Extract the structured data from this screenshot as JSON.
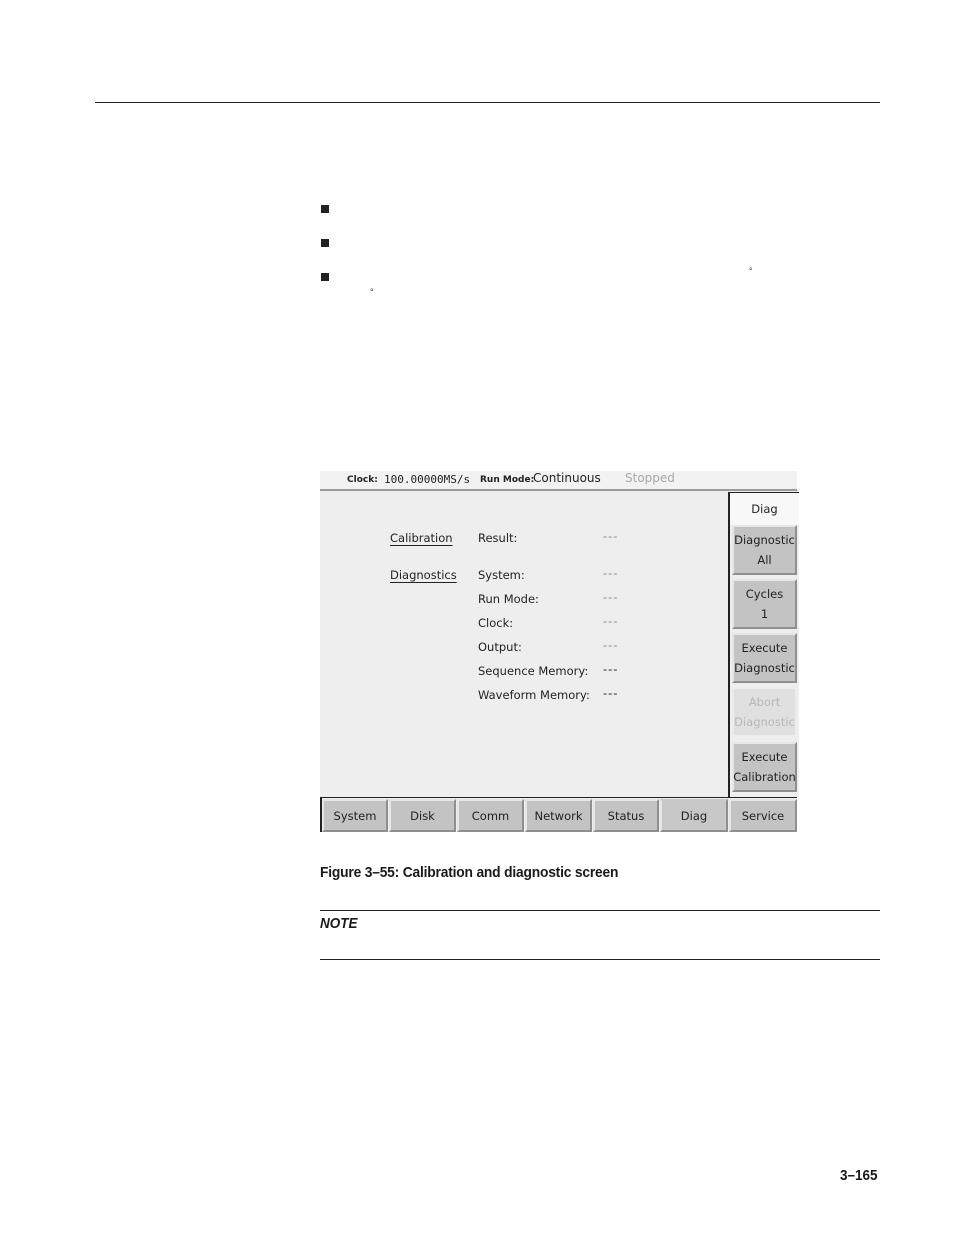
{
  "document": {
    "bullets": [
      "",
      "",
      ""
    ],
    "degree_marks": [
      "°",
      "°"
    ],
    "figure_caption": "Figure 3–55: Calibration and diagnostic screen",
    "note_title": "NOTE",
    "page_number": "3–165"
  },
  "screen": {
    "status_bar": {
      "clock_label": "Clock:",
      "clock_value": "100.00000MS/s",
      "run_mode_label": "Run Mode:",
      "run_mode_value": "Continuous",
      "state": "Stopped"
    },
    "sections": {
      "calibration": "Calibration",
      "diagnostics": "Diagnostics"
    },
    "calibration_rows": [
      {
        "label": "Result:",
        "value": "---"
      }
    ],
    "diagnostic_rows": [
      {
        "label": "System:",
        "value": "---"
      },
      {
        "label": "Run Mode:",
        "value": "---"
      },
      {
        "label": "Clock:",
        "value": "---"
      },
      {
        "label": "Output:",
        "value": "---"
      },
      {
        "label": "Sequence Memory:",
        "value": "---"
      },
      {
        "label": "Waveform Memory:",
        "value": "---"
      }
    ],
    "side_menu": {
      "title": "Diag",
      "buttons": [
        {
          "line1": "Diagnostic",
          "line2": "All",
          "enabled": true
        },
        {
          "line1": "Cycles",
          "line2": "1",
          "enabled": true
        },
        {
          "line1": "Execute",
          "line2": "Diagnostic",
          "enabled": true
        },
        {
          "line1": "Abort",
          "line2": "Diagnostic",
          "enabled": false
        },
        {
          "line1": "Execute",
          "line2": "Calibration",
          "enabled": true
        }
      ]
    },
    "tabs": [
      {
        "label": "System"
      },
      {
        "label": "Disk"
      },
      {
        "label": "Comm"
      },
      {
        "label": "Network"
      },
      {
        "label": "Status"
      },
      {
        "label": "Diag",
        "active": true
      },
      {
        "label": "Service"
      }
    ]
  }
}
